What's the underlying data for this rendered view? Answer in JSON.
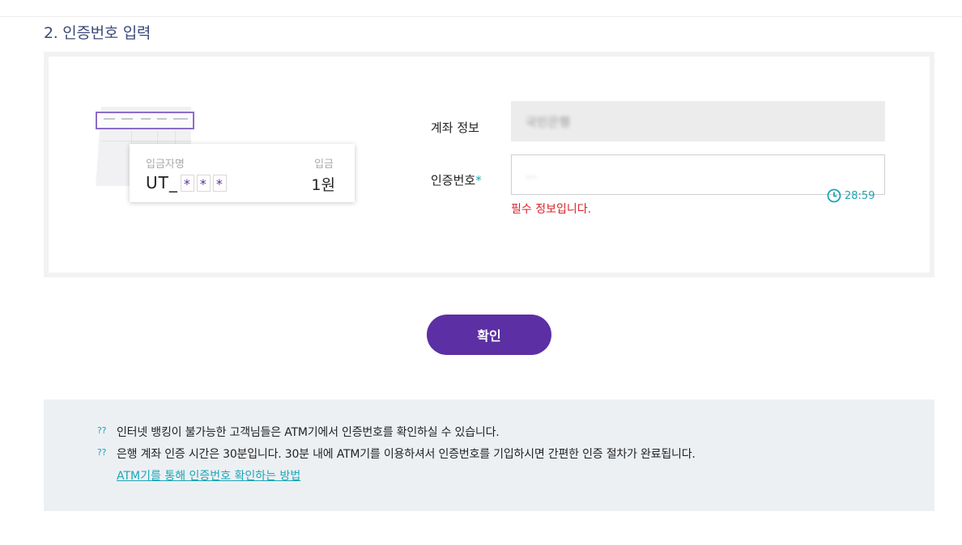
{
  "section": {
    "title": "2. 인증번호 입력"
  },
  "illustration": {
    "name_label": "입금자명",
    "deposit_label": "입금",
    "code_prefix": "UT_",
    "masked": [
      "*",
      "*",
      "*"
    ],
    "amount": "1원"
  },
  "fields": {
    "account_label": "계좌 정보",
    "account_value": "국민은행",
    "code_label": "인증번호",
    "required_mark": "*",
    "code_value": "...",
    "timer": "28:59",
    "error": "필수 정보입니다."
  },
  "confirm_label": "확인",
  "info": {
    "bullet": "??",
    "lines": [
      "인터넷 뱅킹이 불가능한 고객님들은 ATM기에서 인증번호를 확인하실 수 있습니다.",
      "은행 계좌 인증 시간은 30분입니다. 30분 내에 ATM기를 이용하셔서 인증번호를 기입하시면 간편한 인증 절차가 완료됩니다."
    ],
    "link": "ATM기를 통해 인증번호 확인하는 방법"
  },
  "colors": {
    "accent": "#5c2fa4",
    "teal": "#1aa6b7",
    "error": "#d8232a"
  }
}
